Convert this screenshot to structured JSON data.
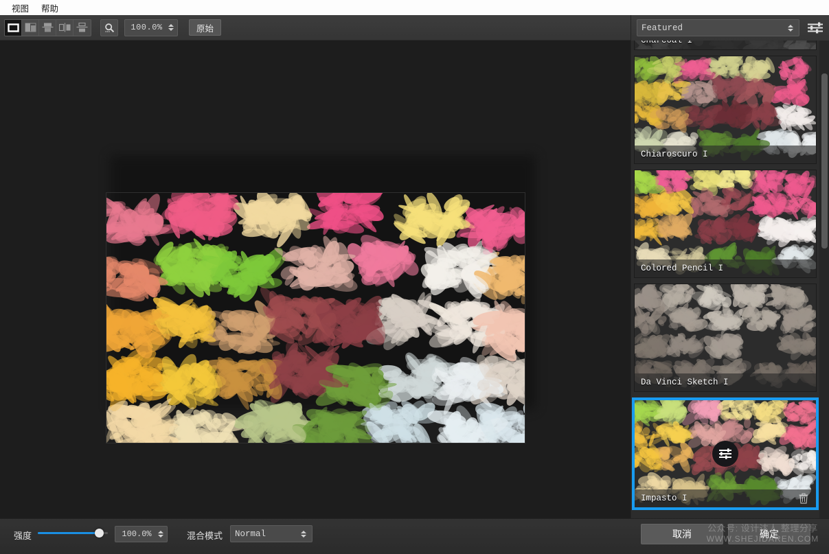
{
  "menubar": {
    "items": [
      {
        "label": "视图",
        "name": "menu-view"
      },
      {
        "label": "帮助",
        "name": "menu-help"
      }
    ]
  },
  "toolbar": {
    "view_modes": [
      {
        "name": "view-single",
        "title": "单视图"
      },
      {
        "name": "view-split-vertical",
        "title": "垂直分割"
      },
      {
        "name": "view-split-horizontal",
        "title": "水平分割"
      },
      {
        "name": "view-side-by-side",
        "title": "并排对比"
      },
      {
        "name": "view-stacked",
        "title": "上下对比"
      }
    ],
    "active_view_index": 0,
    "zoom_icon": "magnifier-icon",
    "zoom_value": "100.0%",
    "original_button": "原始"
  },
  "right_panel": {
    "preset_select": {
      "value": "Featured",
      "icon": "chevron-updown-icon"
    },
    "panel_menu_icon": "sliders-icon",
    "presets": [
      {
        "label": "Charcoal I",
        "name": "preset-charcoal-1",
        "selected": false,
        "style": "charcoal",
        "clipped": true
      },
      {
        "label": "Chiaroscuro I",
        "name": "preset-chiaroscuro-1",
        "selected": false,
        "style": "chiaroscuro",
        "clipped": false
      },
      {
        "label": "Colored Pencil I",
        "name": "preset-colored-pencil-1",
        "selected": false,
        "style": "colored-pencil",
        "clipped": false
      },
      {
        "label": "Da Vinci Sketch I",
        "name": "preset-da-vinci-sketch-1",
        "selected": false,
        "style": "davinci",
        "clipped": false
      },
      {
        "label": "Impasto I",
        "name": "preset-impasto-1",
        "selected": true,
        "style": "impasto",
        "clipped": false,
        "gear_icon": "settings-sliders-icon",
        "delete_icon": "trash-icon"
      }
    ],
    "scrollbar": {
      "name": "preset-scrollbar"
    }
  },
  "bottom_bar": {
    "strength_label": "强度",
    "strength_value": "100.0%",
    "strength_percent": 88,
    "blend_mode_label": "混合模式",
    "blend_mode_value": "Normal",
    "cancel_button": "取消",
    "ok_button": "确定"
  },
  "watermark": {
    "line1": "公众号: 设计达人 整理分享",
    "line2": "WWW.SHEJIDAREN.COM"
  },
  "colors": {
    "accent": "#199bf0",
    "slider": "#1a8fe3",
    "panel_bg": "#2f2f2f",
    "canvas_bg": "#1d1d1d",
    "toolbar_bg": "#3a3a3a"
  }
}
